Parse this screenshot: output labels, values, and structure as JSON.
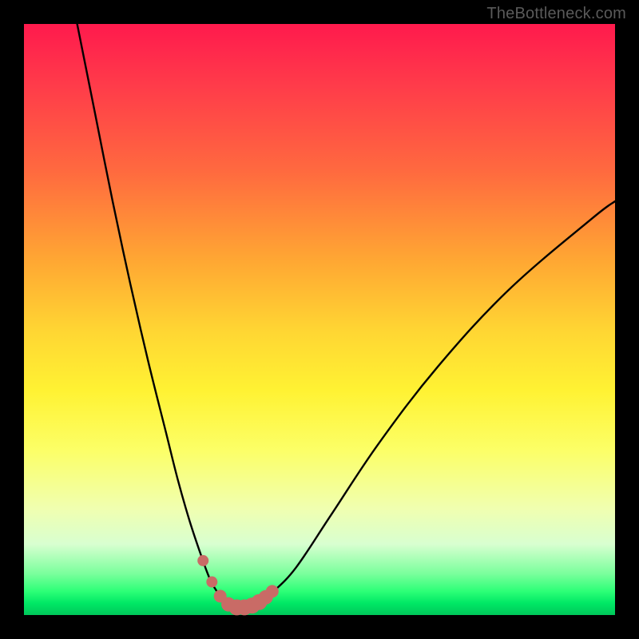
{
  "watermark": "TheBottleneck.com",
  "chart_data": {
    "type": "line",
    "title": "",
    "xlabel": "",
    "ylabel": "",
    "xlim": [
      0,
      100
    ],
    "ylim": [
      0,
      100
    ],
    "series": [
      {
        "name": "bottleneck-curve",
        "x": [
          9,
          12,
          15,
          18,
          21,
          24,
          26,
          28,
          30,
          31.5,
          33,
          34.5,
          36,
          38,
          40,
          42,
          46,
          52,
          60,
          70,
          82,
          96,
          100
        ],
        "values": [
          100,
          85,
          70,
          56,
          43,
          31,
          23,
          16,
          10,
          6,
          3.5,
          2,
          1.5,
          1.5,
          2.2,
          3.8,
          8,
          17,
          29,
          42,
          55,
          67,
          70
        ]
      }
    ],
    "highlight": {
      "name": "trough-markers",
      "x": [
        30.3,
        31.8,
        33.2,
        34.6,
        36.0,
        37.3,
        38.6,
        39.8,
        40.9,
        42.0
      ],
      "values": [
        9.2,
        5.6,
        3.2,
        1.8,
        1.3,
        1.3,
        1.6,
        2.2,
        3.0,
        4.0
      ],
      "radii": [
        7,
        7,
        8,
        9,
        10,
        10,
        10,
        10,
        9,
        8
      ]
    },
    "colors": {
      "curve": "#000000",
      "markers": "#c96b66",
      "gradient_top": "#ff1a4d",
      "gradient_bottom": "#00c75a"
    }
  }
}
